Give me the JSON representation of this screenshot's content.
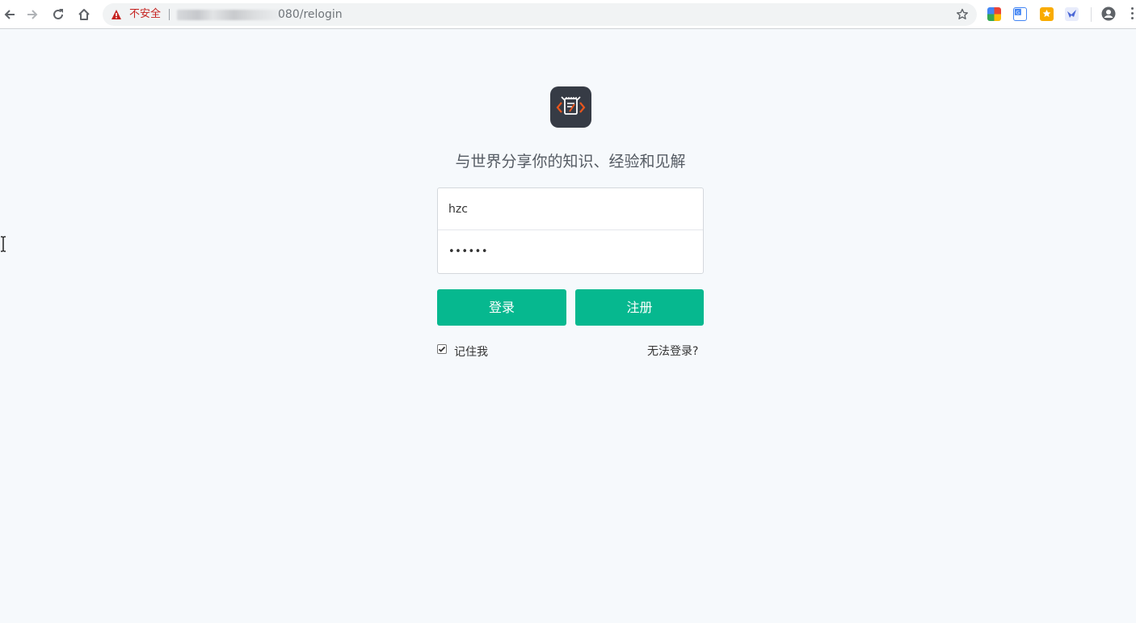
{
  "browser": {
    "security_label": "不安全",
    "url_tail": "080/relogin"
  },
  "page": {
    "slogan": "与世界分享你的知识、经验和见解",
    "username_value": "hzc",
    "password_value": "••••••",
    "login_label": "登录",
    "register_label": "注册",
    "remember_label": "记住我",
    "remember_checked": true,
    "forgot_label": "无法登录?"
  },
  "colors": {
    "accent": "#06b88f",
    "background": "#f6f9fc",
    "logo_bg": "#363b45",
    "logo_accent": "#e8561e",
    "insecure_red": "#c5221f"
  },
  "icons": [
    "back-icon",
    "forward-icon",
    "reload-icon",
    "home-icon",
    "warning-icon",
    "star-icon",
    "profile-icon",
    "menu-icon"
  ]
}
